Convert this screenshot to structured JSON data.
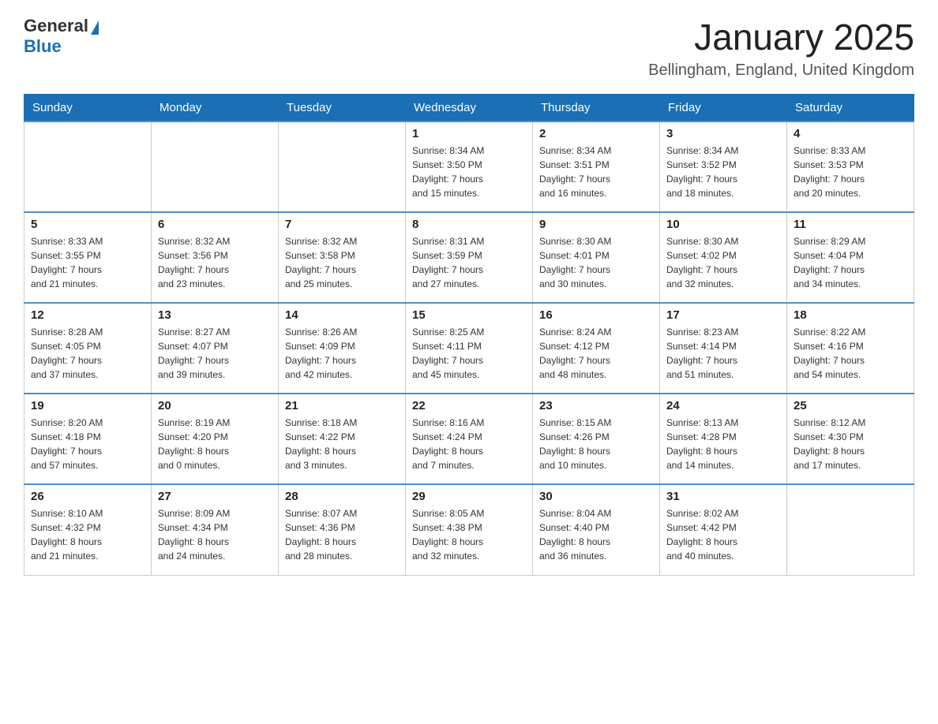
{
  "header": {
    "logo_general": "General",
    "logo_blue": "Blue",
    "month": "January 2025",
    "location": "Bellingham, England, United Kingdom"
  },
  "weekdays": [
    "Sunday",
    "Monday",
    "Tuesday",
    "Wednesday",
    "Thursday",
    "Friday",
    "Saturday"
  ],
  "weeks": [
    [
      {
        "day": "",
        "info": ""
      },
      {
        "day": "",
        "info": ""
      },
      {
        "day": "",
        "info": ""
      },
      {
        "day": "1",
        "info": "Sunrise: 8:34 AM\nSunset: 3:50 PM\nDaylight: 7 hours\nand 15 minutes."
      },
      {
        "day": "2",
        "info": "Sunrise: 8:34 AM\nSunset: 3:51 PM\nDaylight: 7 hours\nand 16 minutes."
      },
      {
        "day": "3",
        "info": "Sunrise: 8:34 AM\nSunset: 3:52 PM\nDaylight: 7 hours\nand 18 minutes."
      },
      {
        "day": "4",
        "info": "Sunrise: 8:33 AM\nSunset: 3:53 PM\nDaylight: 7 hours\nand 20 minutes."
      }
    ],
    [
      {
        "day": "5",
        "info": "Sunrise: 8:33 AM\nSunset: 3:55 PM\nDaylight: 7 hours\nand 21 minutes."
      },
      {
        "day": "6",
        "info": "Sunrise: 8:32 AM\nSunset: 3:56 PM\nDaylight: 7 hours\nand 23 minutes."
      },
      {
        "day": "7",
        "info": "Sunrise: 8:32 AM\nSunset: 3:58 PM\nDaylight: 7 hours\nand 25 minutes."
      },
      {
        "day": "8",
        "info": "Sunrise: 8:31 AM\nSunset: 3:59 PM\nDaylight: 7 hours\nand 27 minutes."
      },
      {
        "day": "9",
        "info": "Sunrise: 8:30 AM\nSunset: 4:01 PM\nDaylight: 7 hours\nand 30 minutes."
      },
      {
        "day": "10",
        "info": "Sunrise: 8:30 AM\nSunset: 4:02 PM\nDaylight: 7 hours\nand 32 minutes."
      },
      {
        "day": "11",
        "info": "Sunrise: 8:29 AM\nSunset: 4:04 PM\nDaylight: 7 hours\nand 34 minutes."
      }
    ],
    [
      {
        "day": "12",
        "info": "Sunrise: 8:28 AM\nSunset: 4:05 PM\nDaylight: 7 hours\nand 37 minutes."
      },
      {
        "day": "13",
        "info": "Sunrise: 8:27 AM\nSunset: 4:07 PM\nDaylight: 7 hours\nand 39 minutes."
      },
      {
        "day": "14",
        "info": "Sunrise: 8:26 AM\nSunset: 4:09 PM\nDaylight: 7 hours\nand 42 minutes."
      },
      {
        "day": "15",
        "info": "Sunrise: 8:25 AM\nSunset: 4:11 PM\nDaylight: 7 hours\nand 45 minutes."
      },
      {
        "day": "16",
        "info": "Sunrise: 8:24 AM\nSunset: 4:12 PM\nDaylight: 7 hours\nand 48 minutes."
      },
      {
        "day": "17",
        "info": "Sunrise: 8:23 AM\nSunset: 4:14 PM\nDaylight: 7 hours\nand 51 minutes."
      },
      {
        "day": "18",
        "info": "Sunrise: 8:22 AM\nSunset: 4:16 PM\nDaylight: 7 hours\nand 54 minutes."
      }
    ],
    [
      {
        "day": "19",
        "info": "Sunrise: 8:20 AM\nSunset: 4:18 PM\nDaylight: 7 hours\nand 57 minutes."
      },
      {
        "day": "20",
        "info": "Sunrise: 8:19 AM\nSunset: 4:20 PM\nDaylight: 8 hours\nand 0 minutes."
      },
      {
        "day": "21",
        "info": "Sunrise: 8:18 AM\nSunset: 4:22 PM\nDaylight: 8 hours\nand 3 minutes."
      },
      {
        "day": "22",
        "info": "Sunrise: 8:16 AM\nSunset: 4:24 PM\nDaylight: 8 hours\nand 7 minutes."
      },
      {
        "day": "23",
        "info": "Sunrise: 8:15 AM\nSunset: 4:26 PM\nDaylight: 8 hours\nand 10 minutes."
      },
      {
        "day": "24",
        "info": "Sunrise: 8:13 AM\nSunset: 4:28 PM\nDaylight: 8 hours\nand 14 minutes."
      },
      {
        "day": "25",
        "info": "Sunrise: 8:12 AM\nSunset: 4:30 PM\nDaylight: 8 hours\nand 17 minutes."
      }
    ],
    [
      {
        "day": "26",
        "info": "Sunrise: 8:10 AM\nSunset: 4:32 PM\nDaylight: 8 hours\nand 21 minutes."
      },
      {
        "day": "27",
        "info": "Sunrise: 8:09 AM\nSunset: 4:34 PM\nDaylight: 8 hours\nand 24 minutes."
      },
      {
        "day": "28",
        "info": "Sunrise: 8:07 AM\nSunset: 4:36 PM\nDaylight: 8 hours\nand 28 minutes."
      },
      {
        "day": "29",
        "info": "Sunrise: 8:05 AM\nSunset: 4:38 PM\nDaylight: 8 hours\nand 32 minutes."
      },
      {
        "day": "30",
        "info": "Sunrise: 8:04 AM\nSunset: 4:40 PM\nDaylight: 8 hours\nand 36 minutes."
      },
      {
        "day": "31",
        "info": "Sunrise: 8:02 AM\nSunset: 4:42 PM\nDaylight: 8 hours\nand 40 minutes."
      },
      {
        "day": "",
        "info": ""
      }
    ]
  ]
}
